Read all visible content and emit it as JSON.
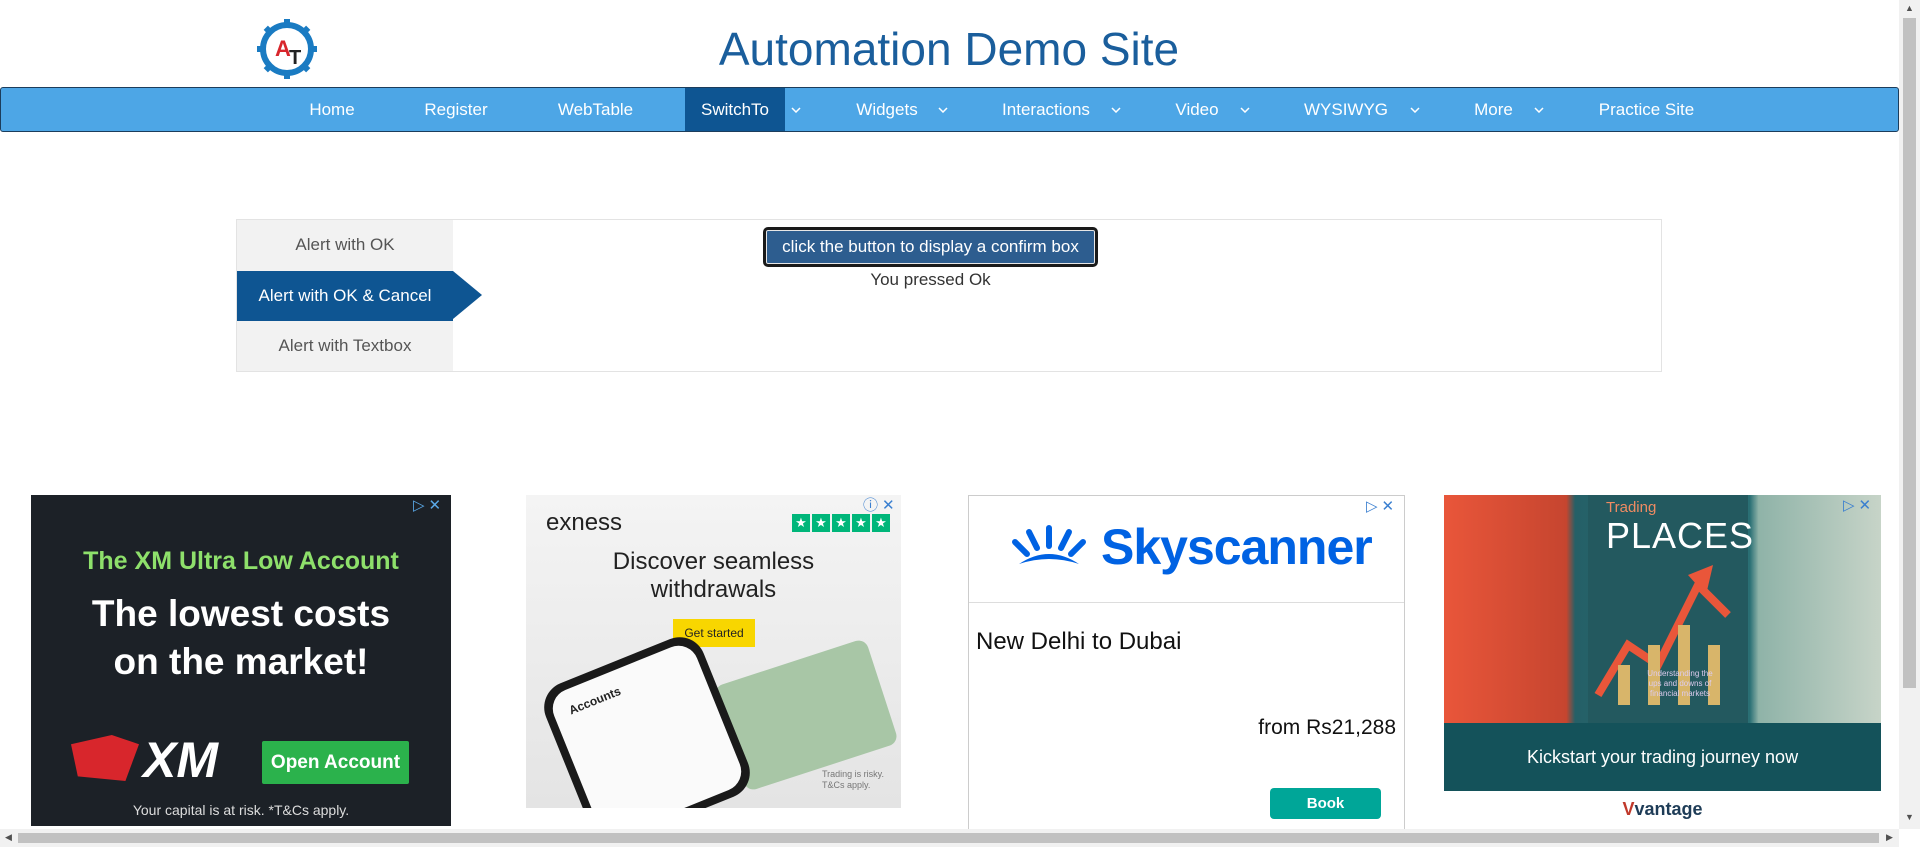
{
  "header": {
    "title": "Automation Demo Site",
    "logo_text": "AT"
  },
  "nav": {
    "items": [
      {
        "label": "Home",
        "dropdown": false
      },
      {
        "label": "Register",
        "dropdown": false
      },
      {
        "label": "WebTable",
        "dropdown": false
      },
      {
        "label": "SwitchTo",
        "dropdown": true,
        "active": true
      },
      {
        "label": "Widgets",
        "dropdown": true
      },
      {
        "label": "Interactions",
        "dropdown": true
      },
      {
        "label": "Video",
        "dropdown": true
      },
      {
        "label": "WYSIWYG",
        "dropdown": true
      },
      {
        "label": "More",
        "dropdown": true
      },
      {
        "label": "Practice Site",
        "dropdown": false
      }
    ]
  },
  "alerts": {
    "tabs": [
      "Alert with OK",
      "Alert with OK & Cancel",
      "Alert with Textbox"
    ],
    "active_tab": 1,
    "button_label": "click the button to display a confirm box",
    "result_text": "You pressed Ok"
  },
  "ads": {
    "xm": {
      "headline": "The XM Ultra Low Account",
      "line1": "The lowest costs",
      "line2": "on the market!",
      "brand": "XM",
      "cta": "Open Account",
      "disclaimer": "Your capital is at risk. *T&Cs apply."
    },
    "exness": {
      "brand": "exness",
      "line1": "Discover seamless",
      "line2": "withdrawals",
      "cta": "Get started",
      "screen_title": "Accounts",
      "disclaimer_1": "Trading is risky.",
      "disclaimer_2": "T&Cs apply."
    },
    "skyscanner": {
      "brand": "Skyscanner",
      "route": "New Delhi to Dubai",
      "price": "from Rs21,288",
      "cta": "Book"
    },
    "vantage": {
      "kicker": "Trading",
      "title": "PLACES",
      "subtitle": "Understanding the ups and downs of financial markets",
      "band": "Kickstart your trading journey now",
      "brand": "vantage"
    }
  },
  "colors": {
    "nav_bg": "#4da6e6",
    "nav_active": "#0e5592",
    "title": "#1a5e9c"
  }
}
